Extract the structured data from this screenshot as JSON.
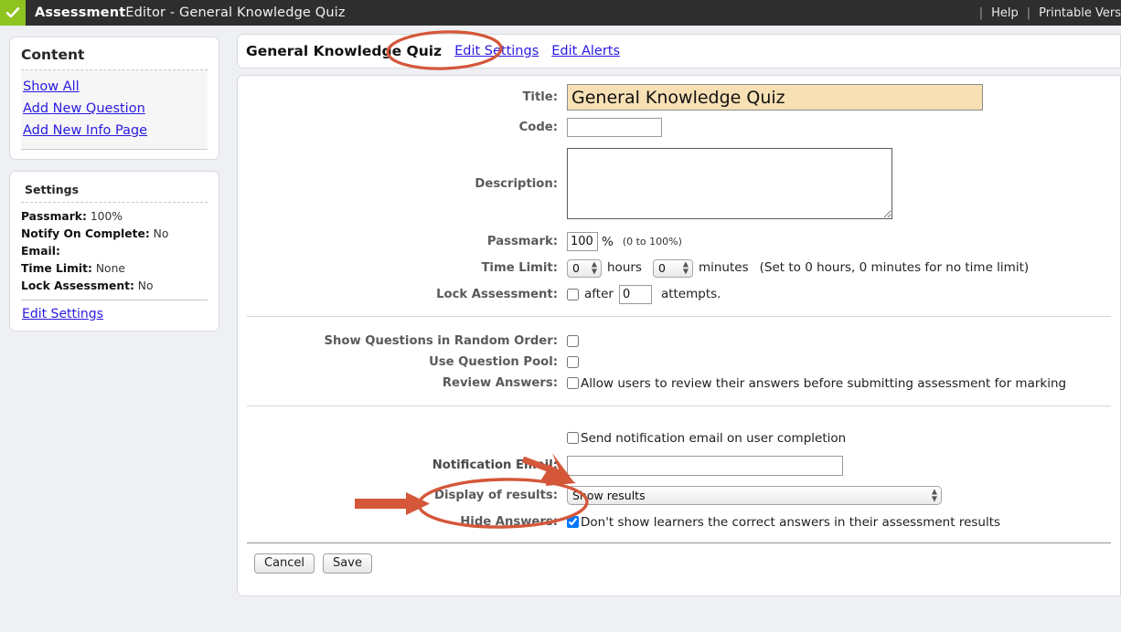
{
  "topbar": {
    "logo_icon": "check-icon",
    "title_bold": "Assessment",
    "title_rest": "Editor - General Knowledge Quiz",
    "sep": "|",
    "help_label": "Help",
    "printable_label": "Printable Vers"
  },
  "sidebar": {
    "content_panel": {
      "title": "Content",
      "links": [
        {
          "label": "Show All"
        },
        {
          "label": "Add New Question"
        },
        {
          "label": "Add New Info Page"
        }
      ]
    },
    "settings_panel": {
      "title": "Settings",
      "rows": [
        {
          "label": "Passmark:",
          "value": "100%"
        },
        {
          "label": "Notify On Complete:",
          "value": "No"
        },
        {
          "label": "Email:",
          "value": ""
        },
        {
          "label": "Time Limit:",
          "value": "None"
        },
        {
          "label": "Lock Assessment:",
          "value": "No"
        }
      ],
      "edit_link": "Edit Settings"
    }
  },
  "main": {
    "head": {
      "quiz_name": "General Knowledge Quiz",
      "edit_settings": "Edit Settings",
      "edit_alerts": "Edit Alerts"
    },
    "form": {
      "title_label": "Title:",
      "title_value": "General Knowledge Quiz",
      "code_label": "Code:",
      "code_value": "",
      "description_label": "Description:",
      "description_value": "",
      "passmark_label": "Passmark:",
      "passmark_value": "100",
      "passmark_unit": "%",
      "passmark_hint": "(0 to 100%)",
      "timelimit_label": "Time Limit:",
      "hours_value": "0",
      "hours_word": "hours",
      "minutes_value": "0",
      "minutes_word": "minutes",
      "timelimit_note": "(Set to 0 hours, 0 minutes for no time limit)",
      "lock_label": "Lock Assessment:",
      "lock_checked": false,
      "lock_after_word": "after",
      "lock_attempts_value": "0",
      "lock_attempts_word": "attempts.",
      "random_label": "Show Questions in Random Order:",
      "random_checked": false,
      "pool_label": "Use Question Pool:",
      "pool_checked": false,
      "review_label": "Review Answers:",
      "review_checked": false,
      "review_text": "Allow users to review their answers before submitting assessment for marking",
      "notify_checked": false,
      "notify_text": "Send notification email on user completion",
      "notification_email_label": "Notification Email:",
      "notification_email_value": "",
      "display_results_label": "Display of results:",
      "display_results_value": "Show results",
      "hide_answers_label": "Hide Answers:",
      "hide_answers_checked": true,
      "hide_answers_text": "Don't show learners the correct answers in their assessment results"
    },
    "buttons": {
      "cancel": "Cancel",
      "save": "Save"
    }
  },
  "annotations": {
    "color": "#d4573a",
    "ellipse_edit_settings": "highlight-ellipse",
    "ellipse_notification_email": "highlight-ellipse",
    "arrow_notify_checkbox": "arrow-annotation",
    "arrow_notification_email": "arrow-annotation"
  }
}
